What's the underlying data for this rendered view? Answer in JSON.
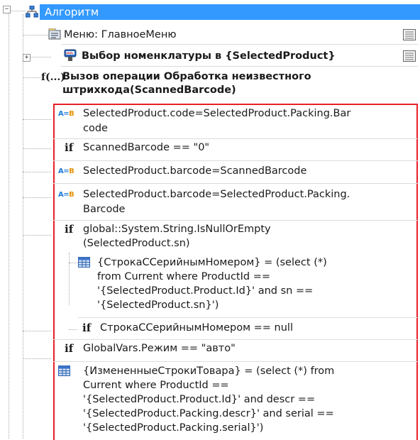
{
  "tree": {
    "root": {
      "label": "Алгоритм"
    },
    "menu_node": {
      "label": "Меню: ГлавноеМеню"
    },
    "select_node": {
      "label": "Выбор номенклатуры в {SelectedProduct}"
    },
    "call_node": {
      "line1": "Вызов операции Обработка неизвестного",
      "line2": "штрихкода(ScannedBarcode)"
    },
    "items": [
      {
        "icon": "assign-icon",
        "lines": [
          "SelectedProduct.code=SelectedProduct.Packing.Bar",
          "code"
        ]
      },
      {
        "icon": "if-icon",
        "keyword": "if",
        "lines": [
          "ScannedBarcode == \"0\""
        ]
      },
      {
        "icon": "assign-icon",
        "lines": [
          "SelectedProduct.barcode=ScannedBarcode"
        ]
      },
      {
        "icon": "assign-icon",
        "lines": [
          "SelectedProduct.barcode=SelectedProduct.Packing.",
          "Barcode"
        ]
      },
      {
        "icon": "if-icon",
        "keyword": "if",
        "lines": [
          "global::System.String.IsNullOrEmpty",
          "(SelectedProduct.sn)"
        ]
      },
      {
        "icon": "table-query-icon",
        "lines": [
          "{СтрокаССерийнымНомером} = (select (*)",
          "from Current where ProductId ==",
          "'{SelectedProduct.Product.Id}' and sn ==",
          "'{SelectedProduct.sn}')"
        ]
      },
      {
        "icon": "if-icon",
        "keyword": "if",
        "lines": [
          "СтрокаССерийнымНомером == null"
        ]
      },
      {
        "icon": "if-icon",
        "keyword": "if",
        "lines": [
          "GlobalVars.Режим == \"авто\""
        ]
      },
      {
        "icon": "table-query-icon",
        "lines": [
          "{ИзмененныеСтрокиТовара} = (select (*) from",
          "Current where ProductId ==",
          "'{SelectedProduct.Product.Id}' and descr ==",
          "'{SelectedProduct.Packing.descr}' and serial ==",
          "'{SelectedProduct.Packing.serial}')"
        ]
      }
    ]
  },
  "labels": {
    "ab_a": "A",
    "ab_eq": "=",
    "ab_b": "B",
    "fx": "f(...)",
    "expander_minus": "−",
    "expander_plus": "+"
  },
  "colors": {
    "selection": "#3399ff",
    "highlight_border": "#e8202a"
  }
}
